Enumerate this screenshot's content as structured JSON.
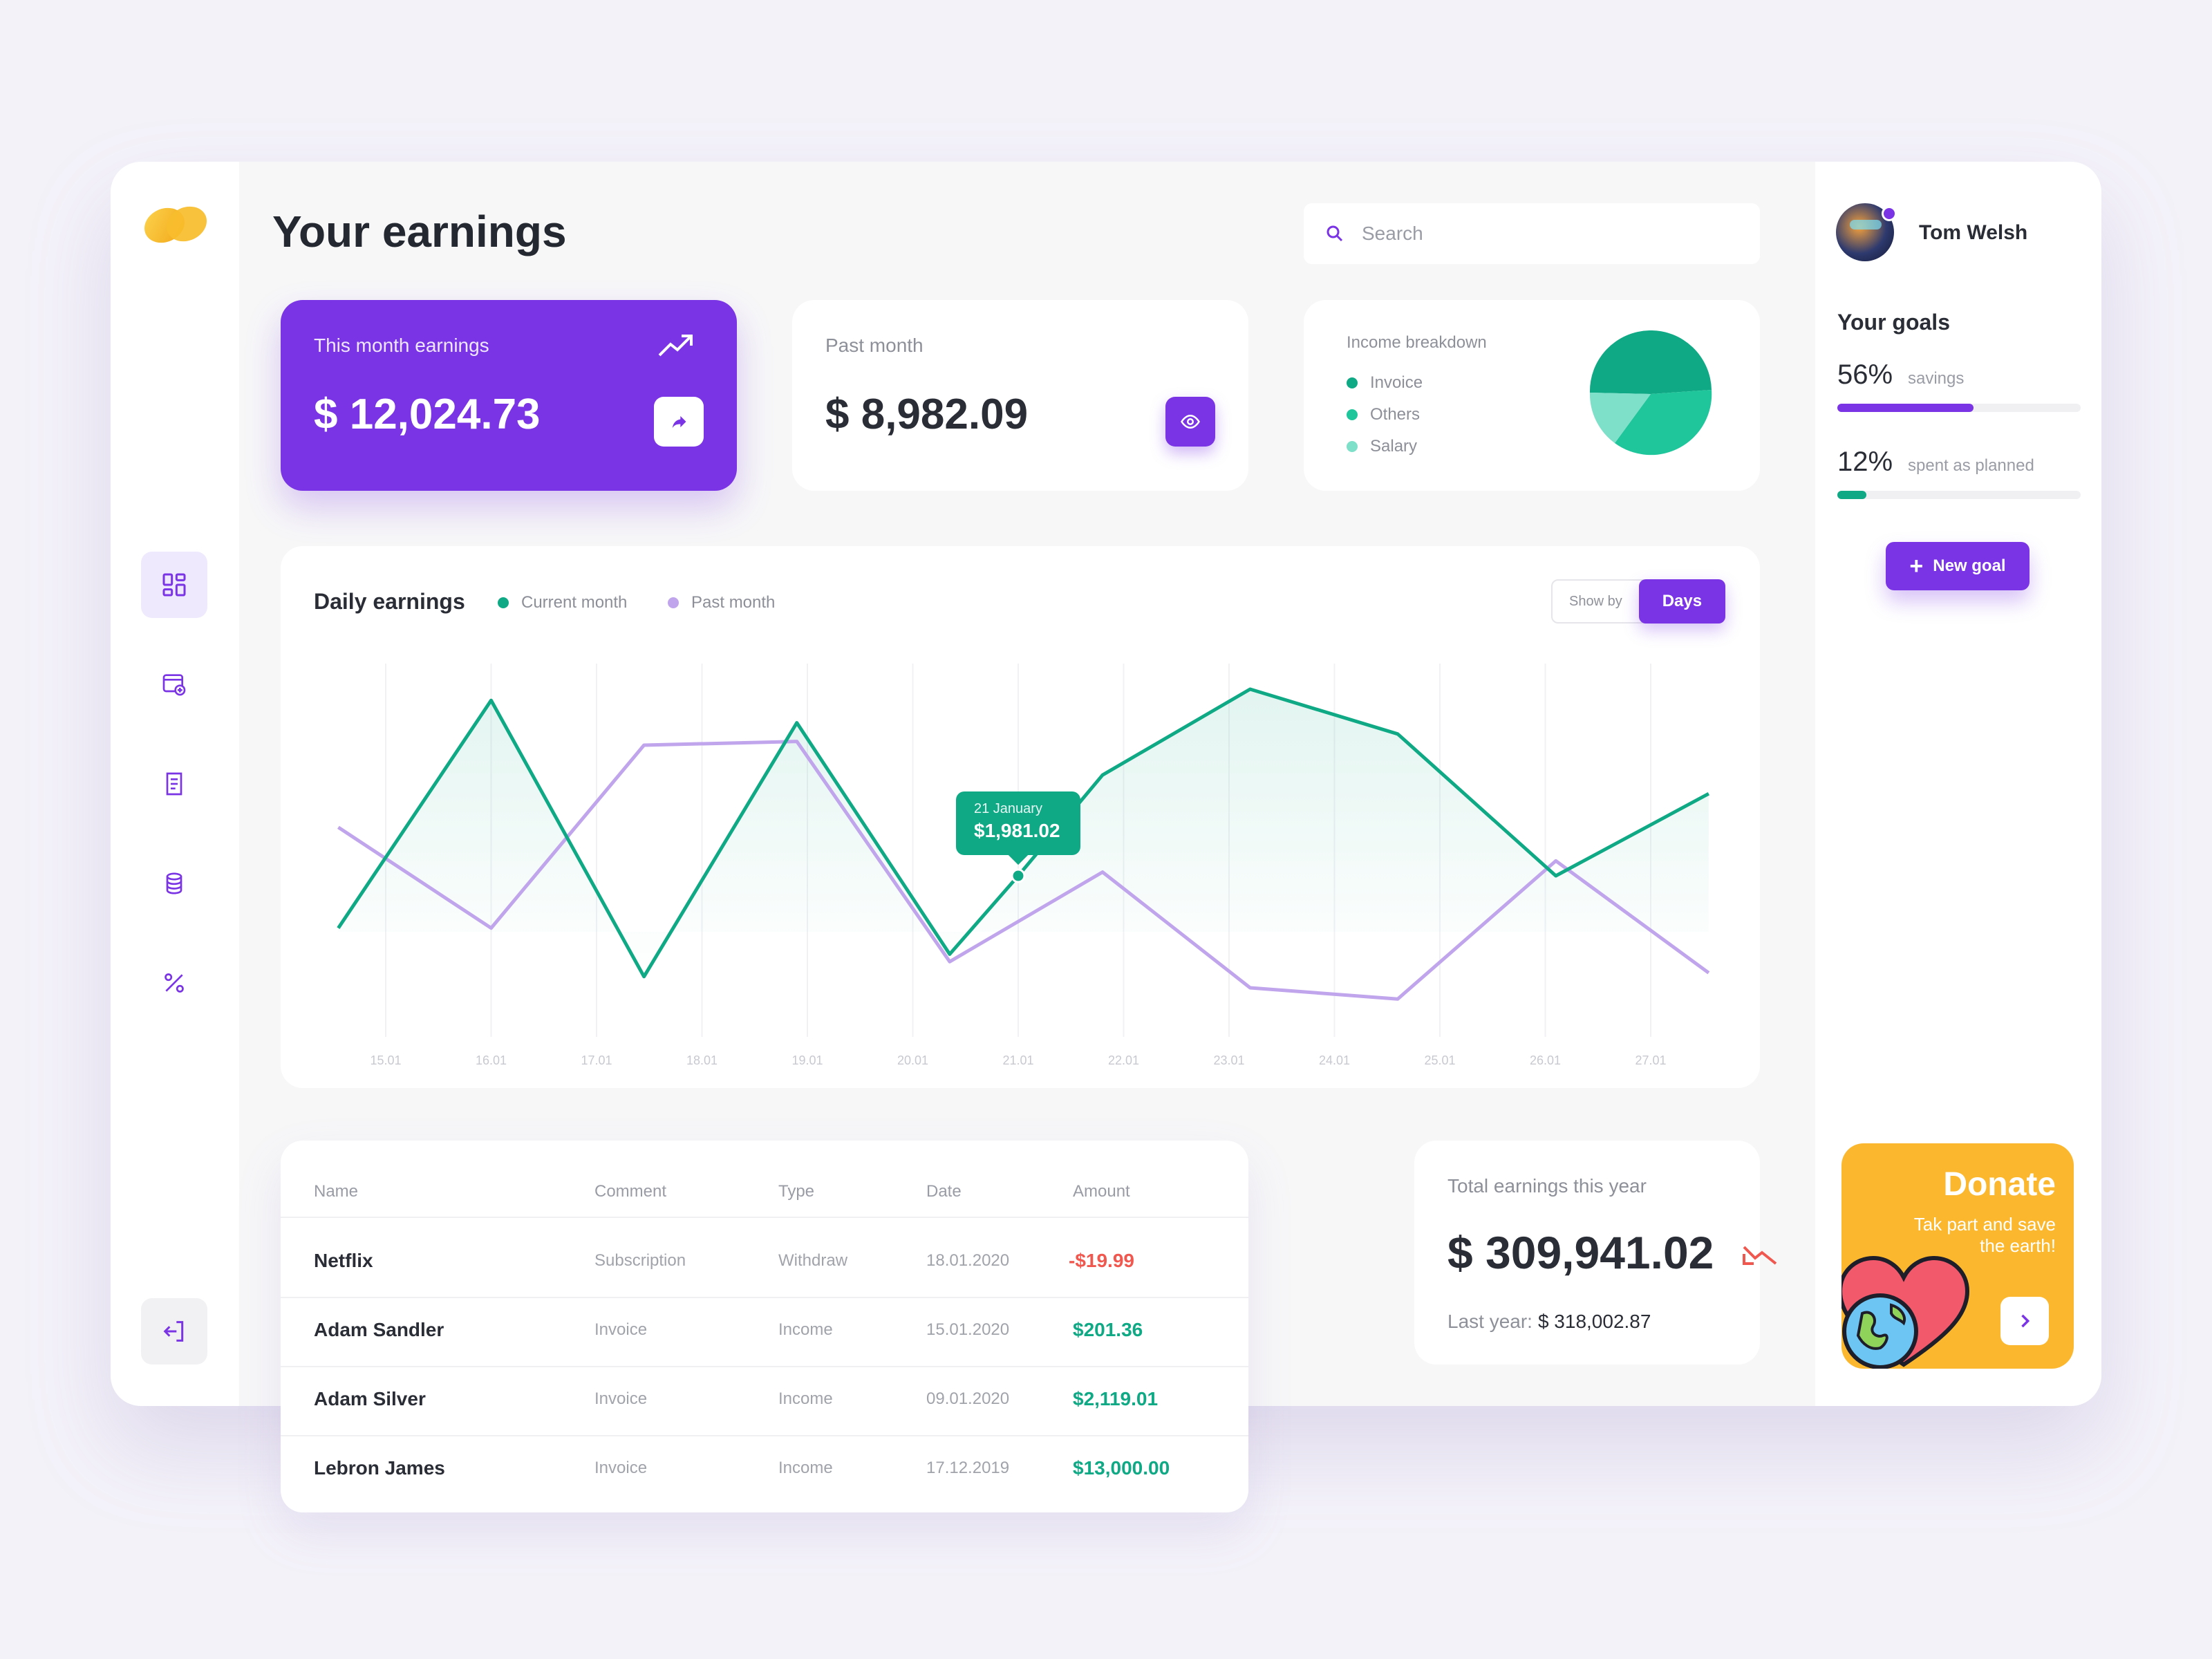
{
  "page": {
    "title": "Your earnings"
  },
  "search": {
    "placeholder": "Search"
  },
  "user": {
    "name": "Tom Welsh"
  },
  "cards": {
    "this_month": {
      "label": "This month earnings",
      "value": "$ 12,024.73"
    },
    "past_month": {
      "label": "Past month",
      "value": "$ 8,982.09"
    },
    "breakdown": {
      "label": "Income breakdown",
      "items": [
        {
          "label": "Invoice",
          "color": "#0fa985"
        },
        {
          "label": "Others",
          "color": "#1fc69b"
        },
        {
          "label": "Salary",
          "color": "#7fe0c9"
        }
      ]
    }
  },
  "chart_data": {
    "type": "line",
    "title": "Daily earnings",
    "legend": [
      "Current month",
      "Past month"
    ],
    "x": [
      "15.01",
      "16.01",
      "17.01",
      "18.01",
      "19.01",
      "20.01",
      "21.01",
      "22.01",
      "23.01",
      "24.01",
      "25.01",
      "26.01",
      "27.01"
    ],
    "series": [
      {
        "name": "Current month",
        "color": "#0fa985",
        "points": [
          [
            14.55,
            0.31
          ],
          [
            16.0,
            0.92
          ],
          [
            17.45,
            0.18
          ],
          [
            18.9,
            0.86
          ],
          [
            20.35,
            0.24
          ],
          [
            21.0,
            0.45
          ],
          [
            21.8,
            0.72
          ],
          [
            23.2,
            0.95
          ],
          [
            24.6,
            0.83
          ],
          [
            26.1,
            0.45
          ],
          [
            27.55,
            0.67
          ]
        ]
      },
      {
        "name": "Past month",
        "color": "#c0a4ec",
        "points": [
          [
            14.55,
            0.58
          ],
          [
            16.0,
            0.31
          ],
          [
            17.45,
            0.8
          ],
          [
            18.9,
            0.81
          ],
          [
            20.35,
            0.22
          ],
          [
            21.8,
            0.46
          ],
          [
            23.2,
            0.15
          ],
          [
            24.6,
            0.12
          ],
          [
            26.1,
            0.49
          ],
          [
            27.55,
            0.19
          ]
        ]
      }
    ],
    "tooltip": {
      "x": "21.01",
      "date": "21 January",
      "value": "$1,981.02"
    },
    "show_by_label": "Show by",
    "show_by_value": "Days"
  },
  "table": {
    "headers": [
      "Name",
      "Comment",
      "Type",
      "Date",
      "Amount"
    ],
    "rows": [
      {
        "name": "Netflix",
        "comment": "Subscription",
        "type": "Withdraw",
        "date": "18.01.2020",
        "amount": "-$19.99",
        "negative": true
      },
      {
        "name": "Adam Sandler",
        "comment": "Invoice",
        "type": "Income",
        "date": "15.01.2020",
        "amount": "$201.36",
        "negative": false
      },
      {
        "name": "Adam Silver",
        "comment": "Invoice",
        "type": "Income",
        "date": "09.01.2020",
        "amount": "$2,119.01",
        "negative": false
      },
      {
        "name": "Lebron James",
        "comment": "Invoice",
        "type": "Income",
        "date": "17.12.2019",
        "amount": "$13,000.00",
        "negative": false
      }
    ]
  },
  "total": {
    "label": "Total earnings this year",
    "value": "$ 309,941.02",
    "last_year_label": "Last year:",
    "last_year_value": "$ 318,002.87"
  },
  "goals": {
    "title": "Your goals",
    "items": [
      {
        "percent": "56%",
        "label": "savings",
        "fraction": 0.56,
        "color": "#7a34e5"
      },
      {
        "percent": "12%",
        "label": "spent as planned",
        "fraction": 0.12,
        "color": "#0fa985"
      }
    ],
    "new_goal_label": "New goal"
  },
  "donate": {
    "title": "Donate",
    "text_line1": "Tak part and save",
    "text_line2": "the earth!"
  },
  "icons": {
    "logo": "logo-icon",
    "nav": [
      "dashboard-icon",
      "wallet-add-icon",
      "receipt-icon",
      "coins-icon",
      "percent-icon"
    ],
    "logout": "logout-icon"
  }
}
